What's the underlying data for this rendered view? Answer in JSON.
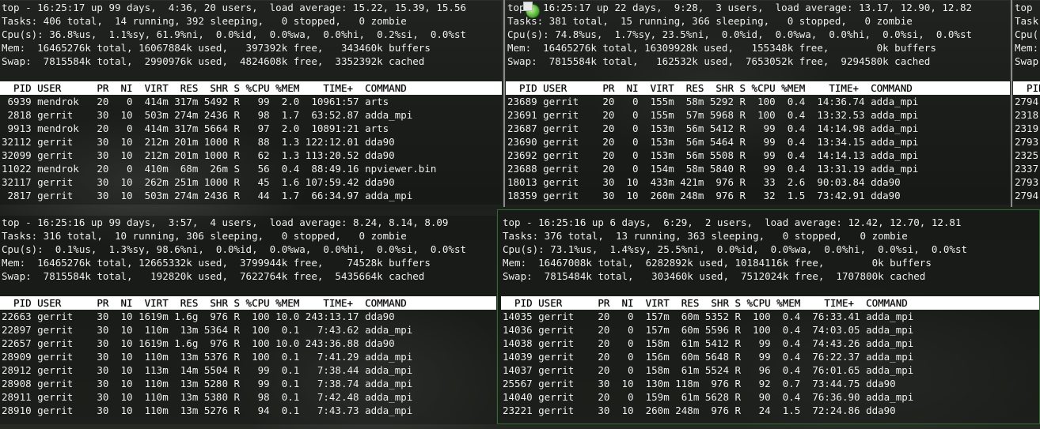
{
  "terminals": [
    {
      "summary": [
        "top - 16:25:17 up 99 days,  4:36, 20 users,  load average: 15.22, 15.39, 15.56",
        "Tasks: 406 total,  14 running, 392 sleeping,   0 stopped,   0 zombie",
        "Cpu(s): 36.8%us,  1.1%sy, 61.9%ni,  0.0%id,  0.0%wa,  0.0%hi,  0.2%si,  0.0%st",
        "Mem:  16465276k total, 16067884k used,   397392k free,   343460k buffers",
        "Swap:  7815584k total,  2990976k used,  4824608k free,  3352392k cached"
      ],
      "header": "  PID USER      PR  NI  VIRT  RES  SHR S %CPU %MEM    TIME+  COMMAND",
      "processes": [
        " 6939 mendrok   20   0  414m 317m 5492 R   99  2.0  10961:57 arts",
        " 2818 gerrit    30  10  503m 274m 2436 R   98  1.7  63:52.87 adda_mpi",
        " 9913 mendrok   20   0  414m 317m 5664 R   97  2.0  10891:21 arts",
        "32112 gerrit    30  10  212m 201m 1000 R   88  1.3 122:12.01 dda90",
        "32099 gerrit    30  10  212m 201m 1000 R   62  1.3 113:20.52 dda90",
        "11022 mendrok   20   0  410m  68m  26m S   56  0.4  88:49.16 npviewer.bin",
        "32117 gerrit    30  10  262m 251m 1000 R   45  1.6 107:59.42 dda90",
        " 2817 gerrit    30  10  503m 274m 2436 R   44  1.7  66:34.97 adda_mpi"
      ]
    },
    {
      "summary": [
        "top - 16:25:17 up 22 days,  9:28,  3 users,  load average: 13.17, 12.90, 12.82",
        "Tasks: 381 total,  15 running, 366 sleeping,   0 stopped,   0 zombie",
        "Cpu(s): 74.8%us,  1.7%sy, 23.5%ni,  0.0%id,  0.0%wa,  0.0%hi,  0.0%si,  0.0%st",
        "Mem:  16465276k total, 16309928k used,   155348k free,        0k buffers",
        "Swap:  7815584k total,   162532k used,  7653052k free,  9294580k cached"
      ],
      "header": "  PID USER      PR  NI  VIRT  RES  SHR S %CPU %MEM    TIME+  COMMAND",
      "processes": [
        "23689 gerrit    20   0  155m  58m 5292 R  100  0.4  14:36.74 adda_mpi",
        "23691 gerrit    20   0  155m  57m 5968 R  100  0.4  13:32.53 adda_mpi",
        "23687 gerrit    20   0  153m  56m 5412 R   99  0.4  14:14.98 adda_mpi",
        "23690 gerrit    20   0  153m  56m 5464 R   99  0.4  13:34.15 adda_mpi",
        "23692 gerrit    20   0  153m  56m 5508 R   99  0.4  14:14.13 adda_mpi",
        "23688 gerrit    20   0  154m  58m 5840 R   99  0.4  13:31.19 adda_mpi",
        "18013 gerrit    30  10  433m 421m  976 R   33  2.6  90:03.84 dda90",
        "18359 gerrit    30  10  260m 248m  976 R   32  1.5  73:42.91 dda90"
      ]
    },
    {
      "summary": [
        "top",
        "Task",
        "Cpu(",
        "Mem:",
        "Swap"
      ],
      "header": "  PID",
      "processes": [
        "2794",
        "2318",
        "2319",
        "2793",
        "2325",
        "2337",
        "2793",
        "2794"
      ]
    },
    {
      "summary": [
        "top - 16:25:16 up 99 days,  3:57,  4 users,  load average: 8.24, 8.14, 8.09",
        "Tasks: 316 total,  10 running, 306 sleeping,   0 stopped,   0 zombie",
        "Cpu(s):  0.1%us,  1.3%sy, 98.6%ni,  0.0%id,  0.0%wa,  0.0%hi,  0.0%si,  0.0%st",
        "Mem:  16465276k total, 12665332k used,  3799944k free,    74528k buffers",
        "Swap:  7815584k total,   192820k used,  7622764k free,  5435664k cached"
      ],
      "header": "  PID USER      PR  NI  VIRT  RES  SHR S %CPU %MEM    TIME+  COMMAND",
      "processes": [
        "22663 gerrit    30  10 1619m 1.6g  976 R  100 10.0 243:13.17 dda90",
        "22897 gerrit    30  10  110m  13m 5364 R  100  0.1   7:43.62 adda_mpi",
        "22657 gerrit    30  10 1619m 1.6g  976 R  100 10.0 243:36.88 dda90",
        "28909 gerrit    30  10  110m  13m 5376 R  100  0.1   7:41.29 adda_mpi",
        "28912 gerrit    30  10  113m  14m 5504 R   99  0.1   7:38.44 adda_mpi",
        "28908 gerrit    30  10  110m  13m 5280 R   99  0.1   7:38.74 adda_mpi",
        "28911 gerrit    30  10  110m  13m 5380 R   98  0.1   7:42.48 adda_mpi",
        "28910 gerrit    30  10  110m  13m 5276 R   94  0.1   7:43.73 adda_mpi"
      ]
    },
    {
      "summary": [
        "top - 16:25:16 up 6 days,  6:29,  2 users,  load average: 12.42, 12.70, 12.81",
        "Tasks: 376 total,  13 running, 363 sleeping,   0 stopped,   0 zombie",
        "Cpu(s): 73.1%us,  1.4%sy, 25.5%ni,  0.0%id,  0.0%wa,  0.0%hi,  0.0%si,  0.0%st",
        "Mem:  16467008k total,  6282892k used, 10184116k free,        0k buffers",
        "Swap:  7815484k total,   303460k used,  7512024k free,  1707800k cached"
      ],
      "header": "  PID USER      PR  NI  VIRT  RES  SHR S %CPU %MEM    TIME+  COMMAND",
      "processes": [
        "14035 gerrit    20   0  157m  60m 5352 R  100  0.4  76:33.41 adda_mpi",
        "14036 gerrit    20   0  157m  60m 5596 R  100  0.4  74:03.05 adda_mpi",
        "14038 gerrit    20   0  158m  61m 5412 R   99  0.4  74:43.26 adda_mpi",
        "14039 gerrit    20   0  156m  60m 5648 R   99  0.4  76:22.37 adda_mpi",
        "14037 gerrit    20   0  158m  61m 5524 R   96  0.4  76:01.65 adda_mpi",
        "25567 gerrit    30  10  130m 118m  976 R   92  0.7  73:44.75 dda90",
        "14040 gerrit    20   0  159m  61m 5628 R   90  0.4  76:36.90 adda_mpi",
        "23221 gerrit    30  10  260m 248m  976 R   24  1.5  72:24.86 dda90"
      ]
    }
  ]
}
